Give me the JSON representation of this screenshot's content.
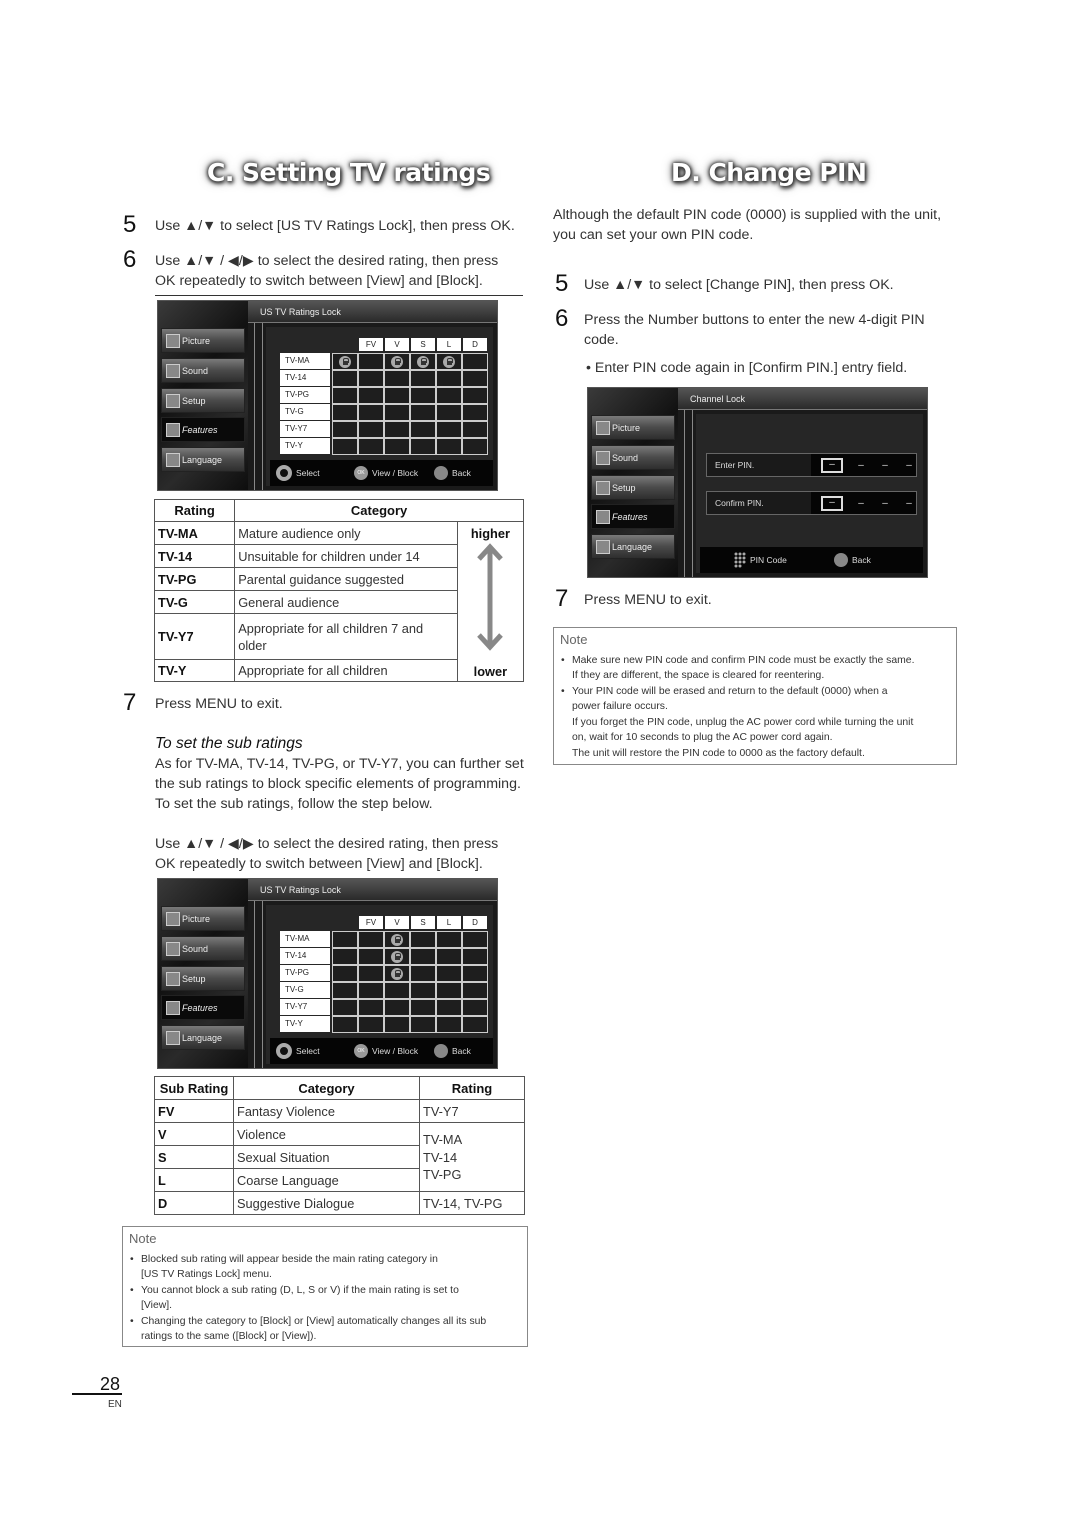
{
  "section_c": {
    "title": "C. Setting TV ratings",
    "step5": {
      "num": "5",
      "text": "Use ▲/▼ to select [US TV Ratings Lock], then press OK."
    },
    "step6": {
      "num": "6",
      "line1": "Use ▲/▼ / ◀/▶ to select the desired rating, then press",
      "line2": "OK repeatedly to switch between [View] and [Block]."
    },
    "step7": {
      "num": "7",
      "text": "Press MENU to exit."
    },
    "sub_heading": "To set the sub ratings",
    "sub_para": [
      "As for TV-MA, TV-14, TV-PG, or TV-Y7, you can further set",
      "the sub ratings to block specific elements of programming.",
      "To set the sub ratings, follow the step below."
    ],
    "sub_step": {
      "line1": "Use ▲/▼ / ◀/▶ to select the desired rating, then press",
      "line2": "OK repeatedly to switch between [View] and [Block]."
    }
  },
  "osd_menu": {
    "items": [
      {
        "label": "Picture",
        "icon": "picture-icon"
      },
      {
        "label": "Sound",
        "icon": "music-note-icon"
      },
      {
        "label": "Setup",
        "icon": "grid-icon"
      },
      {
        "label": "Features",
        "icon": "features-icon",
        "active": true
      },
      {
        "label": "Language",
        "icon": "language-icon"
      }
    ]
  },
  "ratings_osd_1": {
    "title": "US TV Ratings Lock",
    "columns": [
      "FV",
      "V",
      "S",
      "L",
      "D"
    ],
    "rows": [
      "TV-MA",
      "TV-14",
      "TV-PG",
      "TV-G",
      "TV-Y7",
      "TV-Y"
    ],
    "locks": [
      [
        true,
        false,
        true,
        true,
        true,
        false
      ],
      [
        false,
        false,
        false,
        false,
        false,
        false
      ],
      [
        false,
        false,
        false,
        false,
        false,
        false
      ],
      [
        false,
        false,
        false,
        false,
        false,
        false
      ],
      [
        false,
        false,
        false,
        false,
        false,
        false
      ],
      [
        false,
        false,
        false,
        false,
        false,
        false
      ]
    ],
    "footer": {
      "select": "Select",
      "ok_icon": "OK",
      "view_block": "View / Block",
      "back_icon": "BACK",
      "back": "Back"
    }
  },
  "ratings_osd_2": {
    "title": "US TV Ratings Lock",
    "columns": [
      "FV",
      "V",
      "S",
      "L",
      "D"
    ],
    "rows": [
      "TV-MA",
      "TV-14",
      "TV-PG",
      "TV-G",
      "TV-Y7",
      "TV-Y"
    ],
    "locks": [
      [
        false,
        false,
        true,
        false,
        false,
        false
      ],
      [
        false,
        false,
        true,
        false,
        false,
        false
      ],
      [
        false,
        false,
        true,
        false,
        false,
        false
      ],
      [
        false,
        false,
        false,
        false,
        false,
        false
      ],
      [
        false,
        false,
        false,
        false,
        false,
        false
      ],
      [
        false,
        false,
        false,
        false,
        false,
        false
      ]
    ],
    "footer": {
      "select": "Select",
      "ok_icon": "OK",
      "view_block": "View / Block",
      "back_icon": "BACK",
      "back": "Back"
    }
  },
  "rating_table": {
    "headers": [
      "Rating",
      "Category"
    ],
    "rows": [
      {
        "rating": "TV-MA",
        "category": "Mature audience only"
      },
      {
        "rating": "TV-14",
        "category": "Unsuitable for children under 14"
      },
      {
        "rating": "TV-PG",
        "category": "Parental guidance suggested"
      },
      {
        "rating": "TV-G",
        "category": "General audience"
      },
      {
        "rating": "TV-Y7",
        "category": "Appropriate for all children 7 and older"
      },
      {
        "rating": "TV-Y",
        "category": "Appropriate for all children"
      }
    ],
    "higher": "higher",
    "lower": "lower"
  },
  "sub_rating_table": {
    "headers": [
      "Sub Rating",
      "Category",
      "Rating"
    ],
    "rows": [
      {
        "sub": "FV",
        "category": "Fantasy Violence"
      },
      {
        "sub": "V",
        "category": "Violence"
      },
      {
        "sub": "S",
        "category": "Sexual Situation"
      },
      {
        "sub": "L",
        "category": "Coarse Language"
      },
      {
        "sub": "D",
        "category": "Suggestive Dialogue"
      }
    ],
    "rating_fv": "TV-Y7",
    "rating_vsl": [
      "TV-MA",
      "TV-14",
      "TV-PG"
    ],
    "rating_d": "TV-14, TV-PG"
  },
  "note_left": {
    "title": "Note",
    "items": [
      [
        "Blocked sub rating will appear beside the main rating category in",
        "[US TV Ratings Lock] menu."
      ],
      [
        "You cannot block a sub rating (D, L, S or V) if the main rating is set to",
        "[View]."
      ],
      [
        "Changing the category to [Block] or [View] automatically changes all its sub",
        "ratings to the same ([Block] or [View])."
      ]
    ]
  },
  "section_d": {
    "title": "D. Change PIN",
    "intro": [
      "Although the default PIN code (0000) is supplied with the unit,",
      "you can set your own PIN code."
    ],
    "step5": {
      "num": "5",
      "text": "Use ▲/▼ to select [Change PIN], then press OK."
    },
    "step6": {
      "num": "6",
      "line1": "Press the Number buttons to enter the new 4-digit PIN",
      "line2": "code."
    },
    "bullet": "Enter PIN code again in [Confirm PIN.] entry field.",
    "step7": {
      "num": "7",
      "text": "Press MENU to exit."
    }
  },
  "pin_osd": {
    "title": "Channel Lock",
    "enter_label": "Enter PIN.",
    "confirm_label": "Confirm PIN.",
    "digit_placeholder": "–",
    "footer": {
      "pin_code": "PIN Code",
      "back_icon": "BACK",
      "back": "Back"
    }
  },
  "note_right": {
    "title": "Note",
    "items": [
      [
        "Make sure new PIN code and confirm PIN code must be exactly the same.",
        "If they are different, the space is cleared for reentering."
      ],
      [
        "Your PIN code will be erased and return to the default (0000) when a",
        "power failure occurs.",
        "If you forget the PIN code, unplug the AC power cord while turning the unit",
        "on, wait for 10 seconds to plug the AC power cord again.",
        "The unit will restore the PIN code to 0000 as the factory default."
      ]
    ]
  },
  "footer": {
    "page_number": "28",
    "language": "EN"
  }
}
